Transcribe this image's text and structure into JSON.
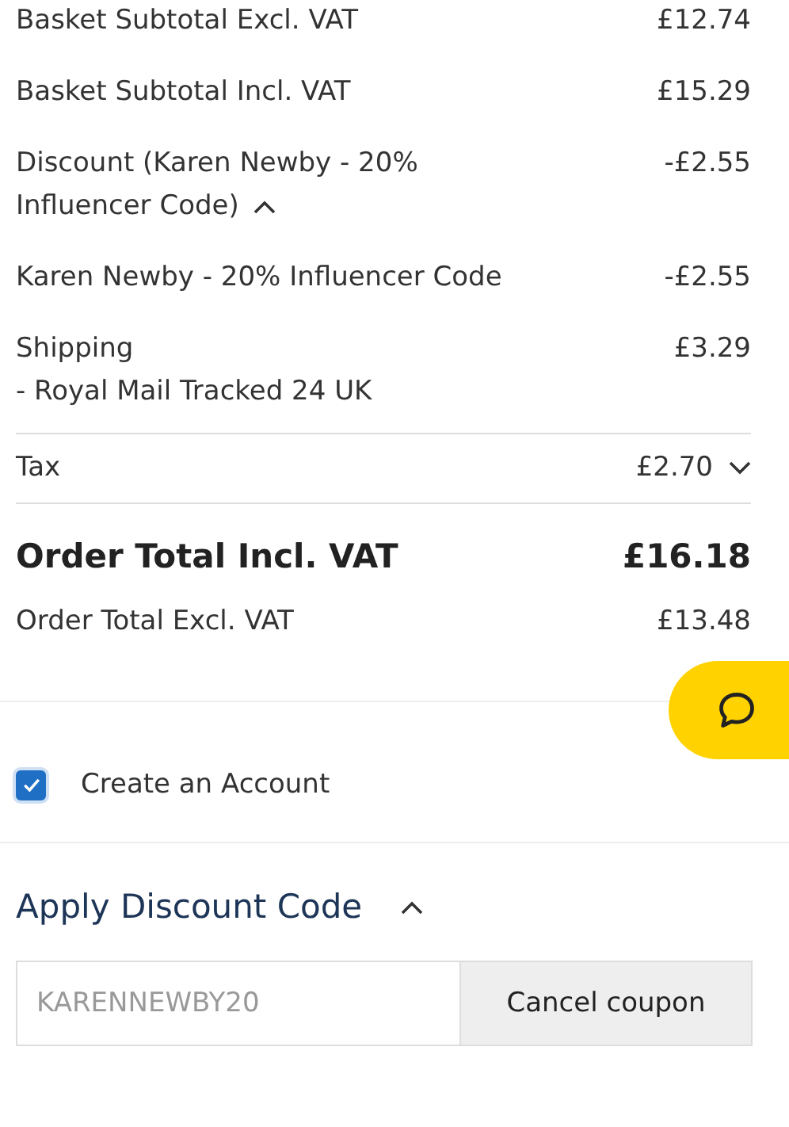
{
  "summary_rows": [
    {
      "label": "Basket Subtotal Excl. VAT",
      "value": "£12.74"
    },
    {
      "label": "Basket Subtotal Incl. VAT",
      "value": "£15.29"
    },
    {
      "label": "Discount (Karen Newby - 20% Influencer Code)",
      "value": "-£2.55",
      "expanded": true
    },
    {
      "label": "Karen Newby - 20% Influencer Code",
      "value": "-£2.55"
    },
    {
      "label": "Shipping",
      "sublabel": "- Royal Mail Tracked 24 UK",
      "value": "£3.29"
    }
  ],
  "tax": {
    "label": "Tax",
    "value": "£2.70",
    "expanded": false
  },
  "order_total": {
    "label": "Order Total Incl. VAT",
    "value": "£16.18"
  },
  "order_total_excl": {
    "label": "Order Total Excl. VAT",
    "value": "£13.48"
  },
  "create_account": {
    "label": "Create an Account",
    "checked": true
  },
  "discount_section": {
    "title": "Apply Discount Code",
    "expanded": true,
    "code": "KARENNEWBY20",
    "button": "Cancel coupon"
  }
}
